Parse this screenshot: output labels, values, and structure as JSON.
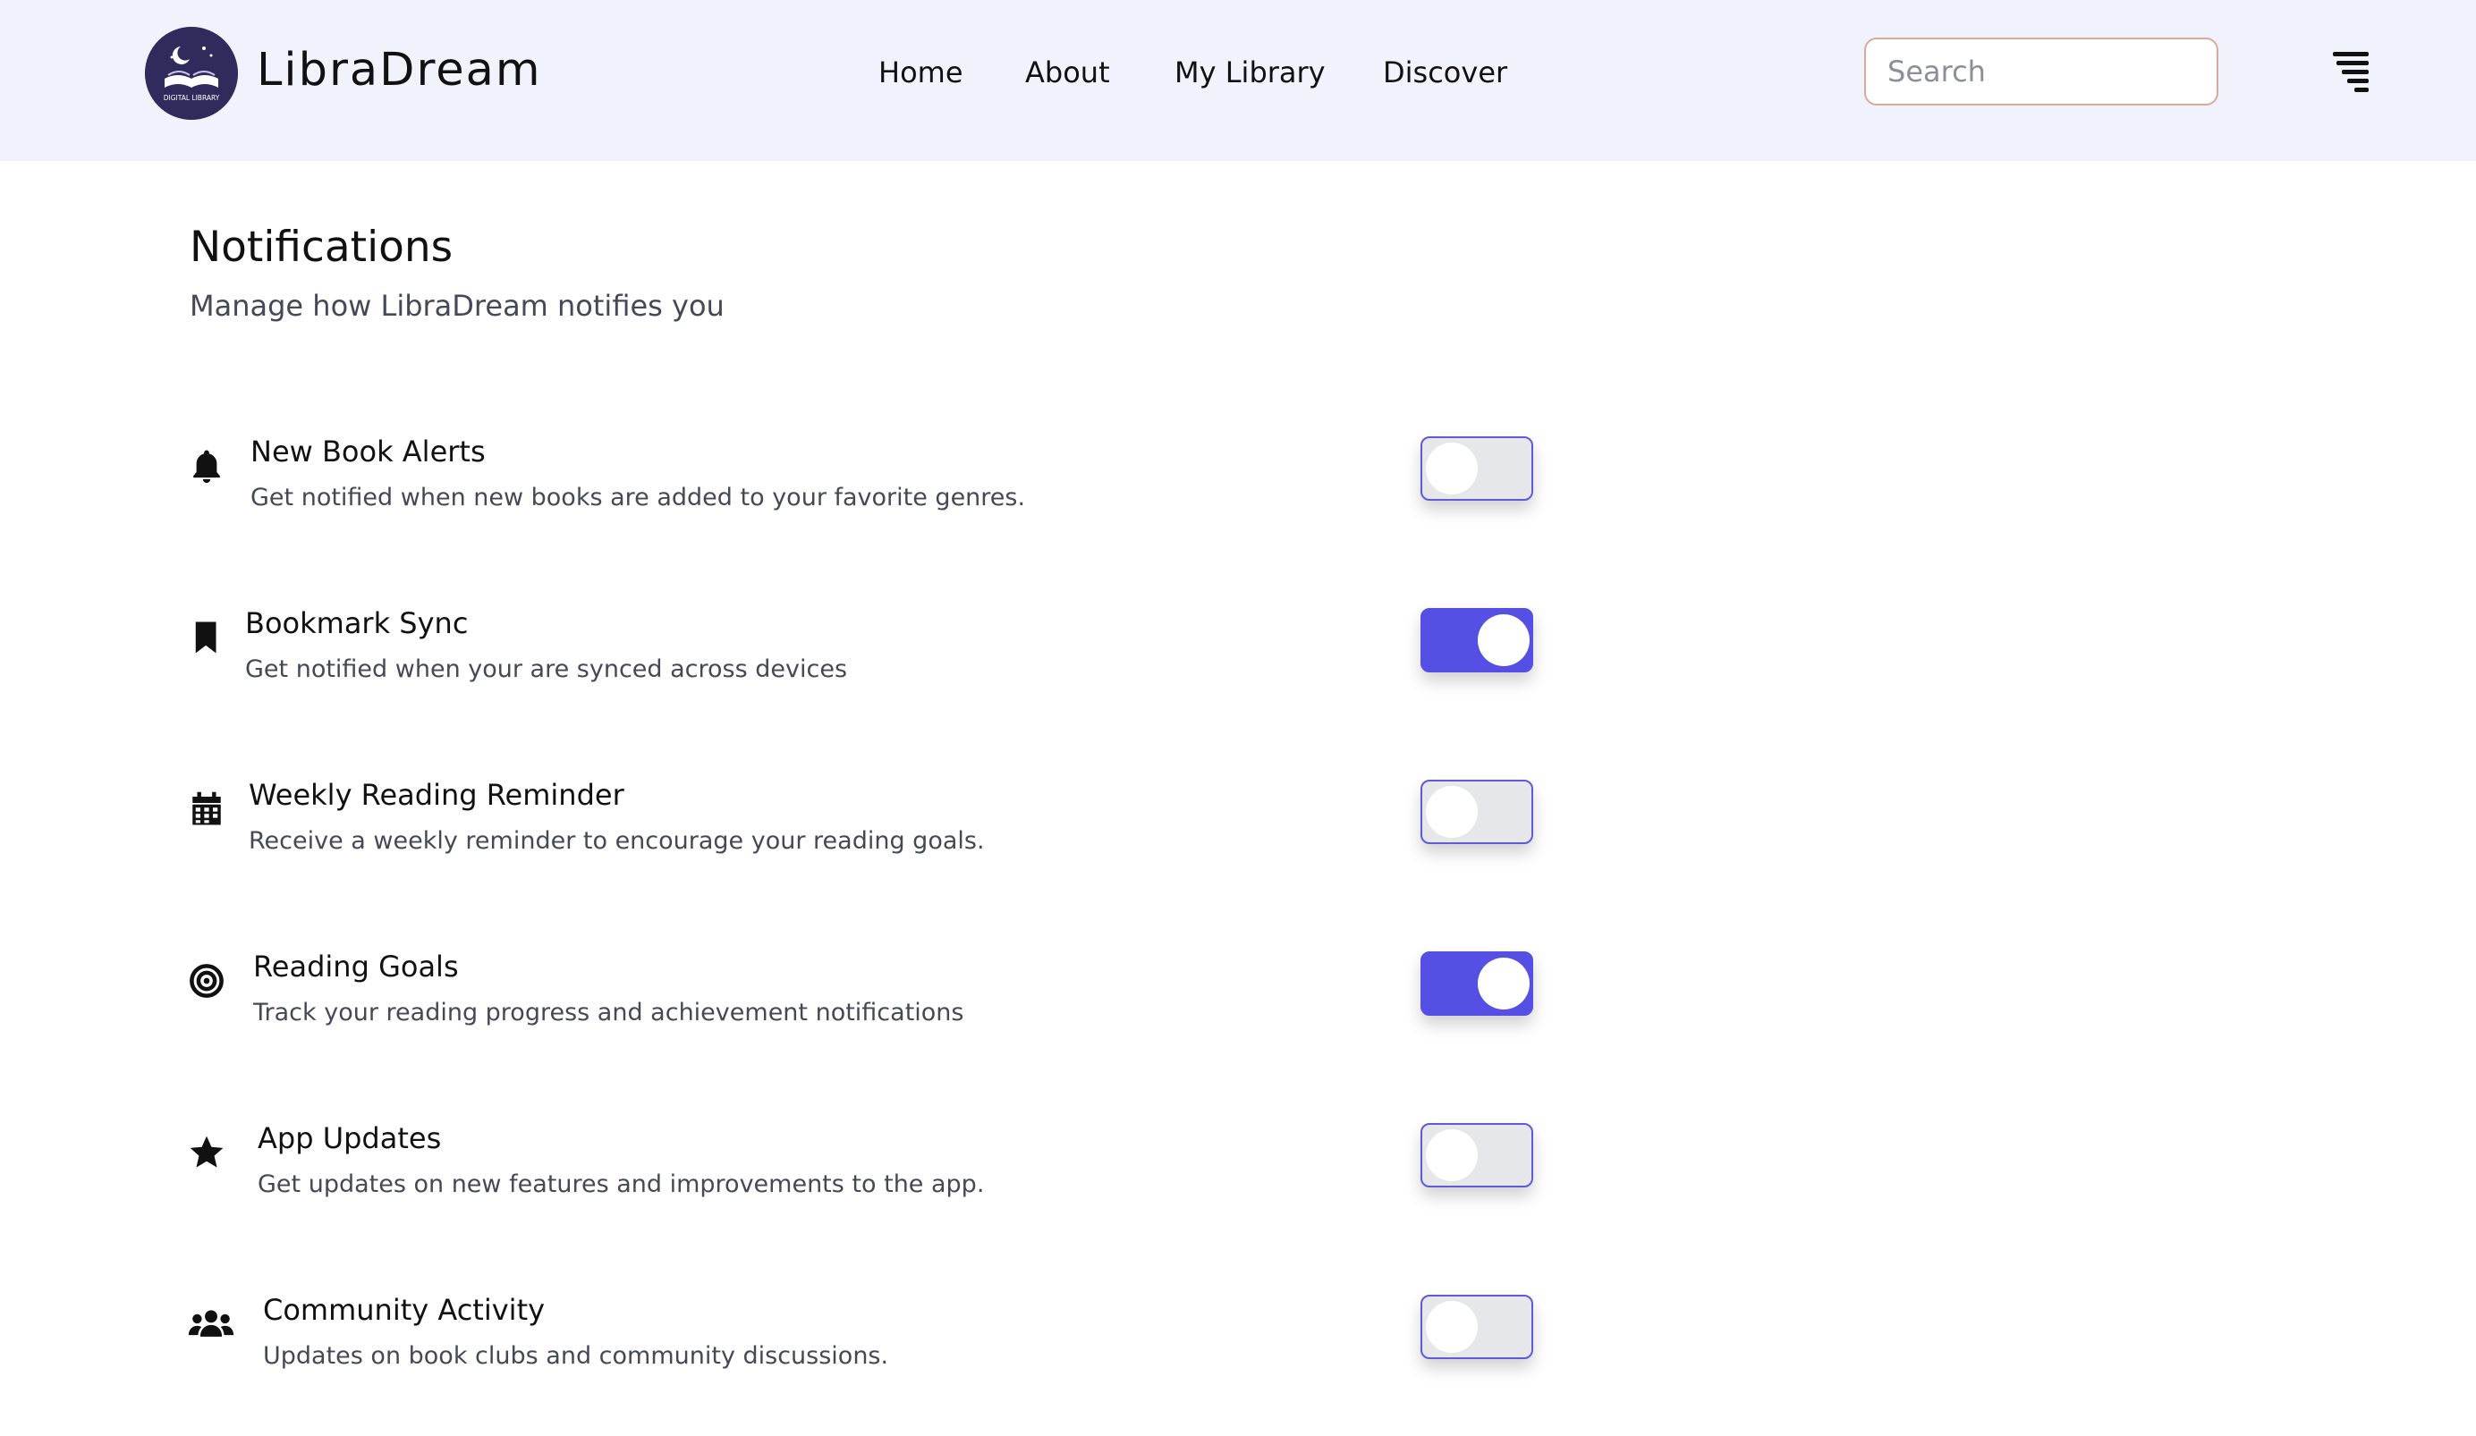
{
  "header": {
    "brand": "LibraDream",
    "logo_text": "DIGITAL LIBRARY",
    "nav": [
      "Home",
      "About",
      "My Library",
      "Discover"
    ],
    "search_placeholder": "Search"
  },
  "page": {
    "title": "Notifications",
    "subtitle": "Manage how LibraDream notifies you"
  },
  "settings": [
    {
      "icon": "bell-icon",
      "title": "New Book Alerts",
      "description": "Get notified when new books are added to your favorite genres.",
      "enabled": false
    },
    {
      "icon": "bookmark-icon",
      "title": "Bookmark Sync",
      "description": "Get notified when your are synced across devices",
      "enabled": true
    },
    {
      "icon": "calendar-icon",
      "title": "Weekly Reading Reminder",
      "description": "Receive a weekly reminder to encourage your reading goals.",
      "enabled": false
    },
    {
      "icon": "target-icon",
      "title": "Reading Goals",
      "description": "Track your reading progress and achievement notifications",
      "enabled": true
    },
    {
      "icon": "star-icon",
      "title": "App Updates",
      "description": "Get updates on new features and improvements to the app.",
      "enabled": false
    },
    {
      "icon": "users-icon",
      "title": "Community Activity",
      "description": "Updates on book clubs and community discussions.",
      "enabled": false
    }
  ],
  "colors": {
    "header_bg": "#f0f3fc",
    "toggle_on": "#5550e3",
    "toggle_off": "#e5e7eb",
    "toggle_border": "#5f5bd8",
    "search_border": "#dba89a",
    "logo_bg": "#2f2b5c"
  }
}
